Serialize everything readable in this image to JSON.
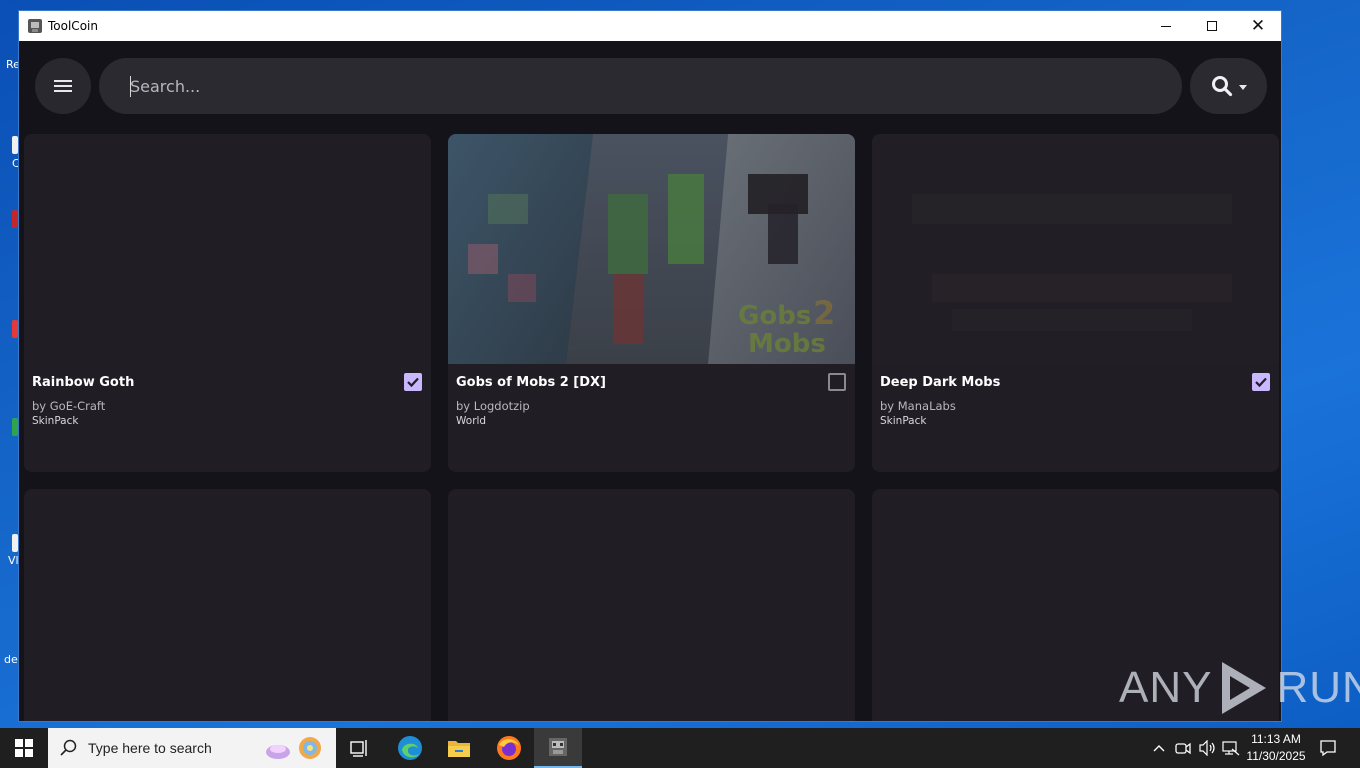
{
  "window": {
    "title": "ToolCoin"
  },
  "window_controls": {
    "minimize": "minimize",
    "maximize": "maximize",
    "close": "close"
  },
  "search": {
    "placeholder": "Search...",
    "value": ""
  },
  "cards": [
    {
      "title": "Rainbow Goth",
      "author": "by GoE-Craft",
      "type": "SkinPack",
      "checked": true
    },
    {
      "title": "Gobs of Mobs 2 [DX]",
      "author": "by Logdotzip",
      "type": "World",
      "checked": false
    },
    {
      "title": "Deep Dark Mobs",
      "author": "by ManaLabs",
      "type": "SkinPack",
      "checked": true
    },
    {
      "title": "",
      "author": "",
      "type": "",
      "checked": false
    },
    {
      "title": "",
      "author": "",
      "type": "",
      "checked": false
    },
    {
      "title": "",
      "author": "",
      "type": "",
      "checked": false
    }
  ],
  "desktop_labels": [
    "Re",
    "C",
    "Vl",
    "de"
  ],
  "watermark": {
    "left": "ANY",
    "right": "RUN"
  },
  "taskbar": {
    "search_placeholder": "Type here to search",
    "clock_time": "11:13 AM",
    "clock_date": "11/30/2025"
  },
  "colors": {
    "accent_checkbox": "#c9b8ff",
    "app_bg": "#15131a",
    "card_bg": "#201e24",
    "search_bg": "#2c2a31"
  },
  "icons": [
    "menu-icon",
    "search-icon",
    "dropdown-arrow-icon",
    "checkbox-checked-icon",
    "checkbox-unchecked-icon",
    "windows-start-icon",
    "task-view-icon",
    "edge-icon",
    "file-explorer-icon",
    "firefox-icon",
    "toolcoin-app-icon",
    "chevron-up-icon",
    "meet-icon",
    "volume-icon",
    "network-icon",
    "notification-icon"
  ]
}
